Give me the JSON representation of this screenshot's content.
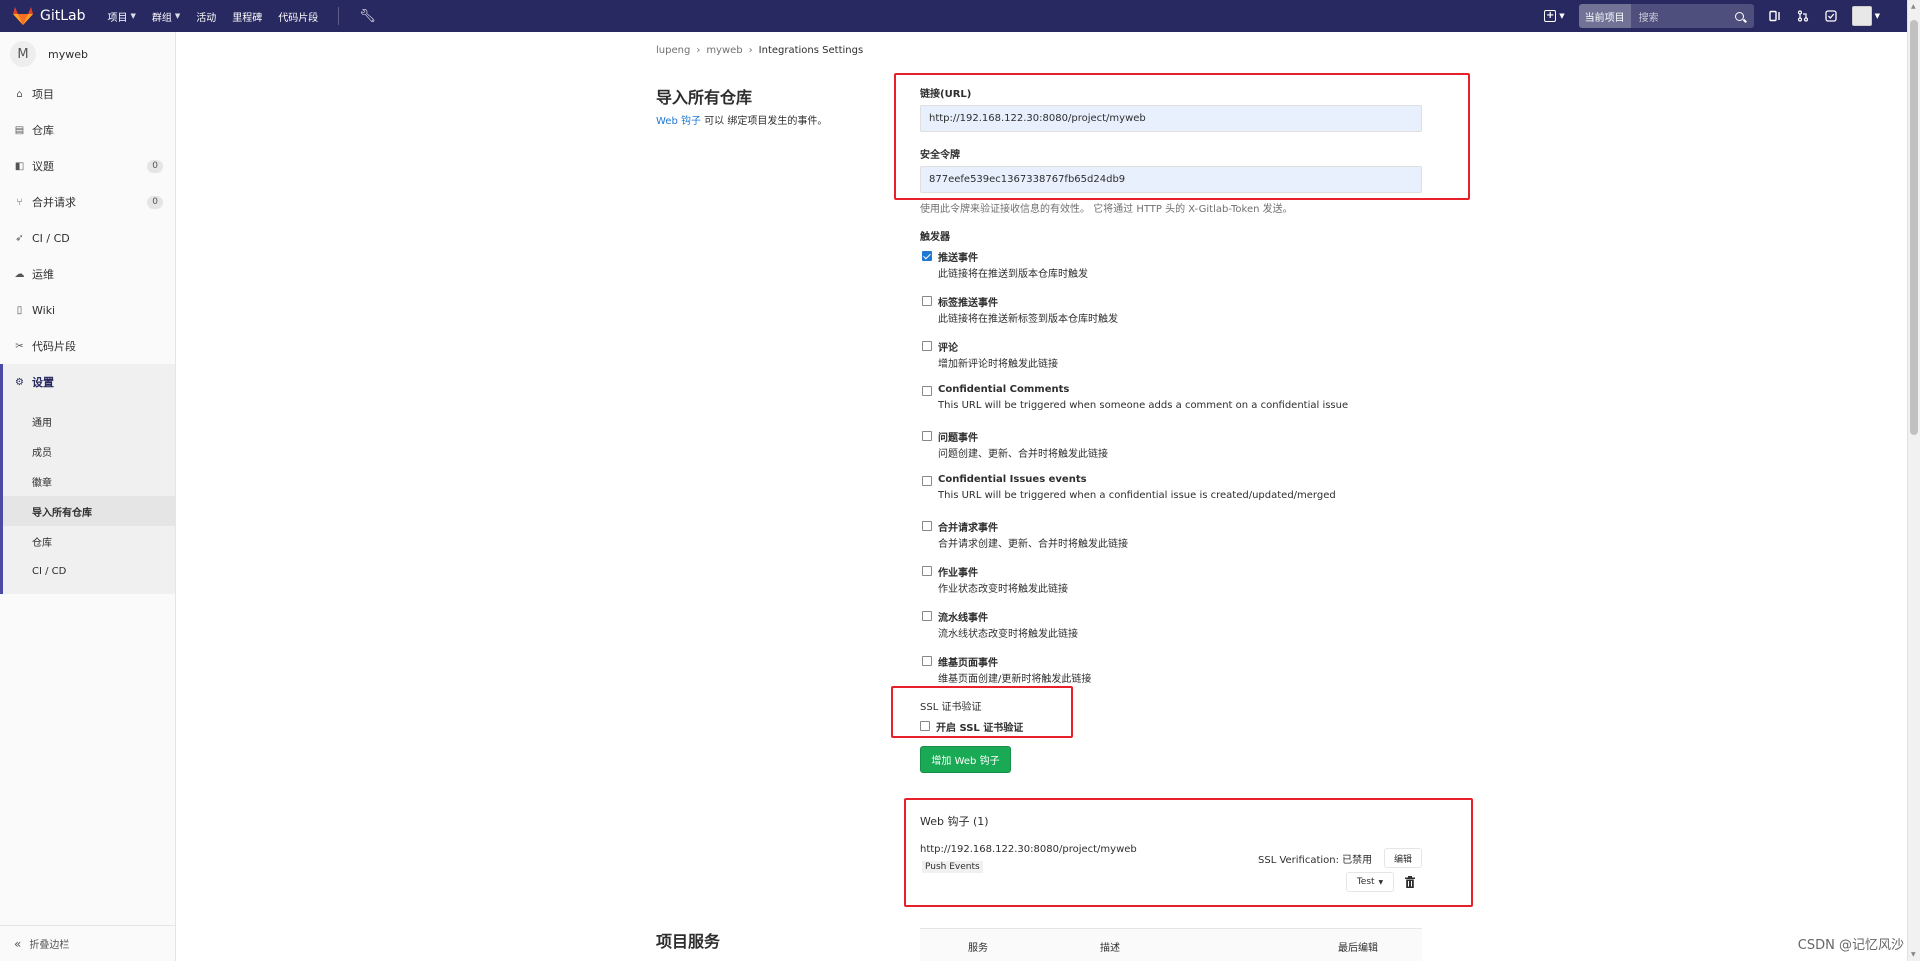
{
  "topbar": {
    "brand": "GitLab",
    "nav": [
      "项目",
      "群组",
      "活动",
      "里程碑",
      "代码片段"
    ],
    "search_scope": "当前项目",
    "search_placeholder": "搜索"
  },
  "sidebar": {
    "project_initial": "M",
    "project_name": "myweb",
    "items": [
      {
        "label": "项目"
      },
      {
        "label": "仓库"
      },
      {
        "label": "议题",
        "count": "0"
      },
      {
        "label": "合并请求",
        "count": "0"
      },
      {
        "label": "CI / CD"
      },
      {
        "label": "运维"
      },
      {
        "label": "Wiki"
      },
      {
        "label": "代码片段"
      },
      {
        "label": "设置"
      }
    ],
    "sub_items": [
      "通用",
      "成员",
      "徽章",
      "导入所有仓库",
      "仓库",
      "CI / CD"
    ],
    "collapse_label": "折叠边栏"
  },
  "breadcrumb": [
    "lupeng",
    "myweb",
    "Integrations Settings"
  ],
  "left": {
    "title": "导入所有仓库",
    "desc_link": "Web 钩子",
    "desc_rest": "可以 绑定项目发生的事件。"
  },
  "form": {
    "url_label": "链接(URL)",
    "url_value": "http://192.168.122.30:8080/project/myweb",
    "token_label": "安全令牌",
    "token_value": "877eefe539ec1367338767fb65d24db9",
    "token_help": "使用此令牌来验证接收信息的有效性。 它将通过 HTTP 头的 X-Gitlab-Token 发送。",
    "triggers_label": "触发器",
    "triggers": [
      {
        "name": "推送事件",
        "desc": "此链接将在推送到版本仓库时触发",
        "checked": true
      },
      {
        "name": "标签推送事件",
        "desc": "此链接将在推送新标签到版本仓库时触发",
        "checked": false
      },
      {
        "name": "评论",
        "desc": "增加新评论时将触发此链接",
        "checked": false
      },
      {
        "name": "Confidential Comments",
        "desc": "This URL will be triggered when someone adds a comment on a confidential issue",
        "checked": false
      },
      {
        "name": "问题事件",
        "desc": "问题创建、更新、合并时将触发此链接",
        "checked": false
      },
      {
        "name": "Confidential Issues events",
        "desc": "This URL will be triggered when a confidential issue is created/updated/merged",
        "checked": false
      },
      {
        "name": "合并请求事件",
        "desc": "合并请求创建、更新、合并时将触发此链接",
        "checked": false
      },
      {
        "name": "作业事件",
        "desc": "作业状态改变时将触发此链接",
        "checked": false
      },
      {
        "name": "流水线事件",
        "desc": "流水线状态改变时将触发此链接",
        "checked": false
      },
      {
        "name": "维基页面事件",
        "desc": "维基页面创建/更新时将触发此链接",
        "checked": false
      }
    ],
    "ssl_label": "SSL 证书验证",
    "ssl_option": "开启 SSL 证书验证",
    "ssl_checked": false,
    "submit_label": "增加 Web 钩子"
  },
  "hooks": {
    "title": "Web 钩子 (1)",
    "url": "http://192.168.122.30:8080/project/myweb",
    "badge": "Push Events",
    "ssl_state": "SSL Verification: 已禁用",
    "edit_label": "编辑",
    "test_label": "Test"
  },
  "services": {
    "title": "项目服务",
    "columns": [
      "服务",
      "描述",
      "最后编辑"
    ]
  },
  "watermark": "CSDN @记忆风沙"
}
